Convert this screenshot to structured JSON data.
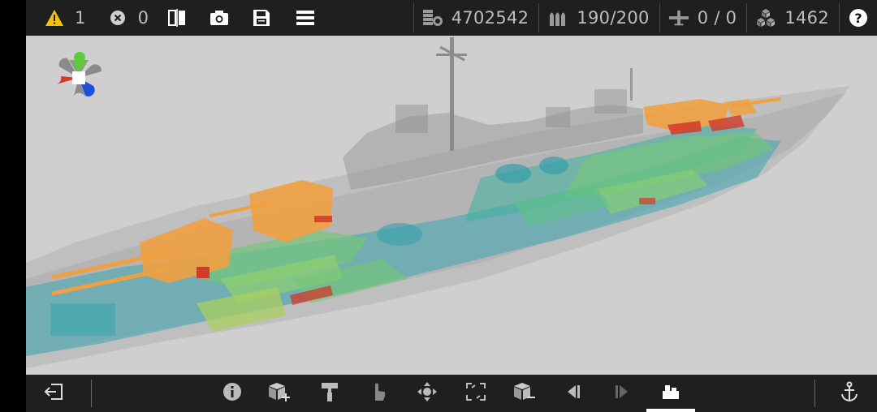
{
  "topbar": {
    "warnings": {
      "icon": "warning-icon",
      "count": "1"
    },
    "errors": {
      "icon": "error-icon",
      "count": "0"
    },
    "tools": [
      "mirror-icon",
      "camera-icon",
      "save-icon",
      "menu-icon"
    ]
  },
  "stats": {
    "cost": {
      "icon": "coins-icon",
      "value": "4702542"
    },
    "ammo": {
      "icon": "ammo-icon",
      "value": "190/200"
    },
    "aircraft": {
      "icon": "aircraft-icon",
      "value": "0 / 0"
    },
    "blocks": {
      "icon": "blocks-icon",
      "value": "1462"
    },
    "help": {
      "icon": "help-icon",
      "label": "?"
    }
  },
  "bottombar": {
    "tools": [
      "exit-icon",
      "info-icon",
      "add-block-icon",
      "paint-icon",
      "touch-icon",
      "move-icon",
      "bounds-icon",
      "remove-block-icon",
      "prev-icon",
      "next-icon",
      "part-select-icon",
      "anchor-icon"
    ],
    "active": "part-select-icon"
  },
  "colors": {
    "bar": "#1f1f1f",
    "viewport": "#cfcfcf",
    "turret": "#f0a040",
    "armor_green": "#74c67a",
    "armor_teal": "#3aa7b0",
    "armor_red": "#d23a2a",
    "warning": "#f4c20d"
  }
}
